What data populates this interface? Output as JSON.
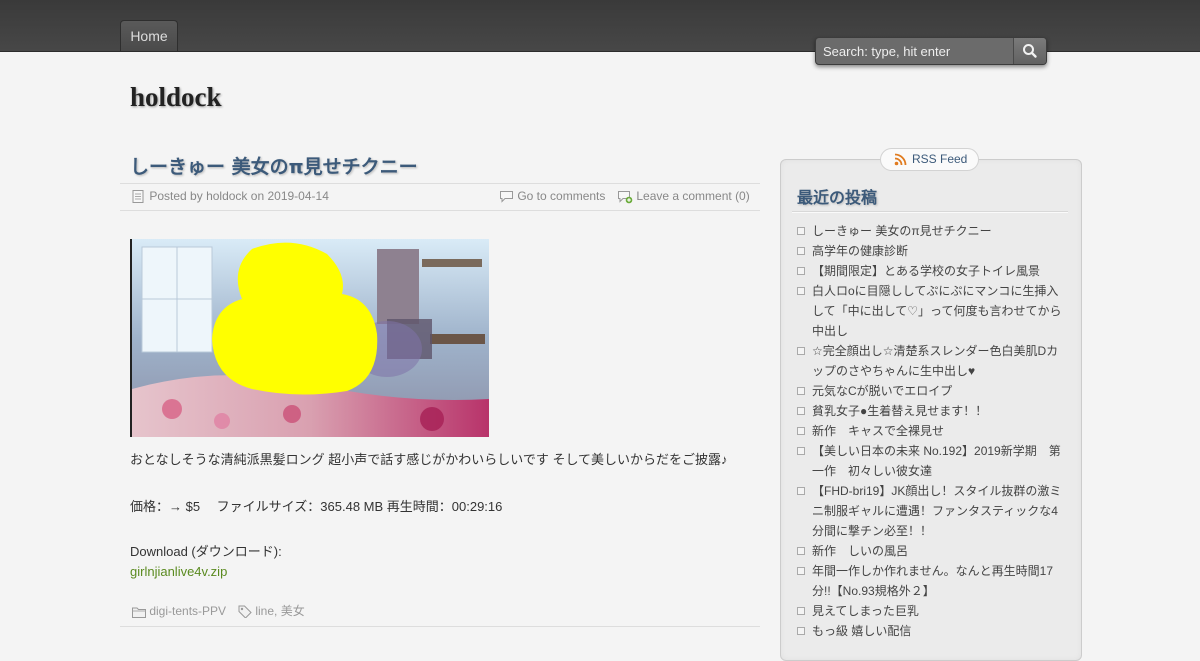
{
  "nav": {
    "home_label": "Home"
  },
  "search": {
    "placeholder": "Search: type, hit enter"
  },
  "site": {
    "title": "holdock"
  },
  "post": {
    "title": "しーきゅー 美女のπ見せチクニー",
    "posted_by_prefix": "Posted by",
    "author": "holdock",
    "on_word": "on",
    "date": "2019-04-14",
    "go_to_comments": "Go to comments",
    "leave_comment": "Leave a comment (0)",
    "description": "おとなしそうな清純派黒髪ロング 超小声で話す感じがかわいらしいです そして美しいからだをご披露♪",
    "price_line": "価格：→ $5　 ファイルサイズ：365.48 MB 再生時間：00:29:16",
    "download_label": "Download (ダウンロード):",
    "download_file": "girlnjianlive4v.zip",
    "category": "digi-tents-PPV",
    "tag1": "line",
    "tag_sep": ",",
    "tag2": "美女"
  },
  "sidebar": {
    "rss_label": "RSS Feed",
    "recent_title": "最近の投稿",
    "recent_posts": [
      "しーきゅー 美女のπ見せチクニー",
      "高学年の健康診断",
      "【期間限定】とある学校の女子トイレ風景",
      "白人ロoに目隠ししてぷにぷにマンコに生挿入して「中に出して♡」って何度も言わせてから中出し",
      "☆完全顔出し☆清楚系スレンダー色白美肌Dカップのさやちゃんに生中出し♥",
      "元気なCが脱いでエロイプ",
      "貧乳女子●生着替え見せます！！",
      "新作　キャスで全裸見せ",
      "【美しい日本の未来 No.192】2019新学期　第一作　初々しい彼女達",
      "【FHD-bri19】JK顔出し！スタイル抜群の激ミニ制服ギャルに遭遇！ファンタスティックな4分間に撃チン必至！！",
      "新作　しいの風呂",
      "年間一作しか作れません。なんと再生時間17分!!【No.93規格外２】",
      "見えてしまった巨乳",
      "もっ級 嬉しい配信"
    ]
  }
}
